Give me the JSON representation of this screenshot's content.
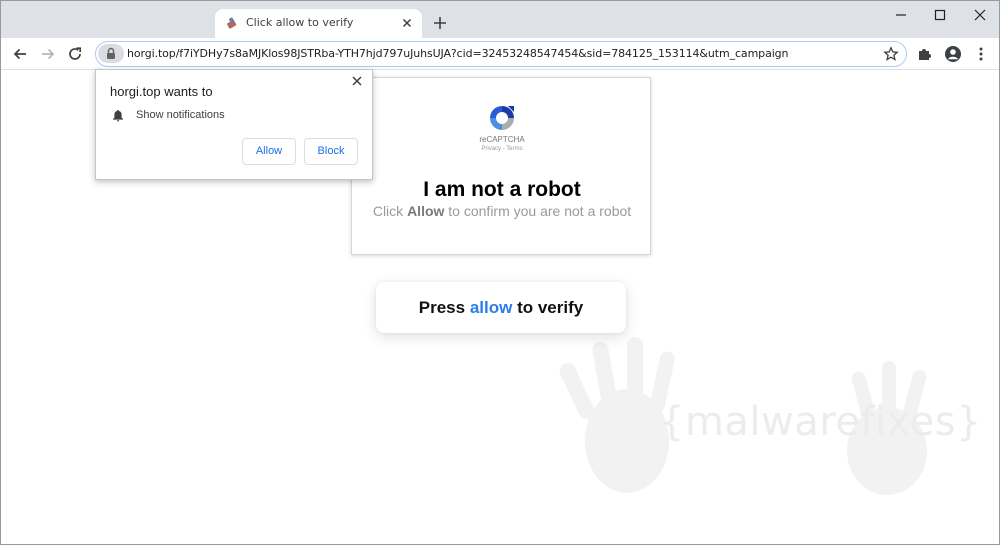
{
  "tab": {
    "title": "Click allow to verify",
    "favicon": "tab-favicon-icon"
  },
  "toolbar": {
    "url": "horgi.top/f7iYDHy7s8aMJKlos98JSTRba-YTH7hjd797uJuhsUJA?cid=32453248547454&sid=784125_153114&utm_campaign"
  },
  "popup": {
    "title": "horgi.top wants to",
    "permission": "Show notifications",
    "allow_label": "Allow",
    "block_label": "Block"
  },
  "captcha": {
    "brand": "reCAPTCHA",
    "links": "Privacy - Terms",
    "title": "I am not a robot",
    "sub_prefix": "Click",
    "sub_bold": "Allow",
    "sub_suffix": "to confirm you are not a robot"
  },
  "press": {
    "prefix": "Press",
    "highlight": "allow",
    "suffix": "to verify"
  },
  "watermark": {
    "text": "{malwarefixes}"
  },
  "colors": {
    "tabstrip": "#dee1e6",
    "accent": "#2b7de9",
    "popup_button_text": "#1a73e8"
  }
}
